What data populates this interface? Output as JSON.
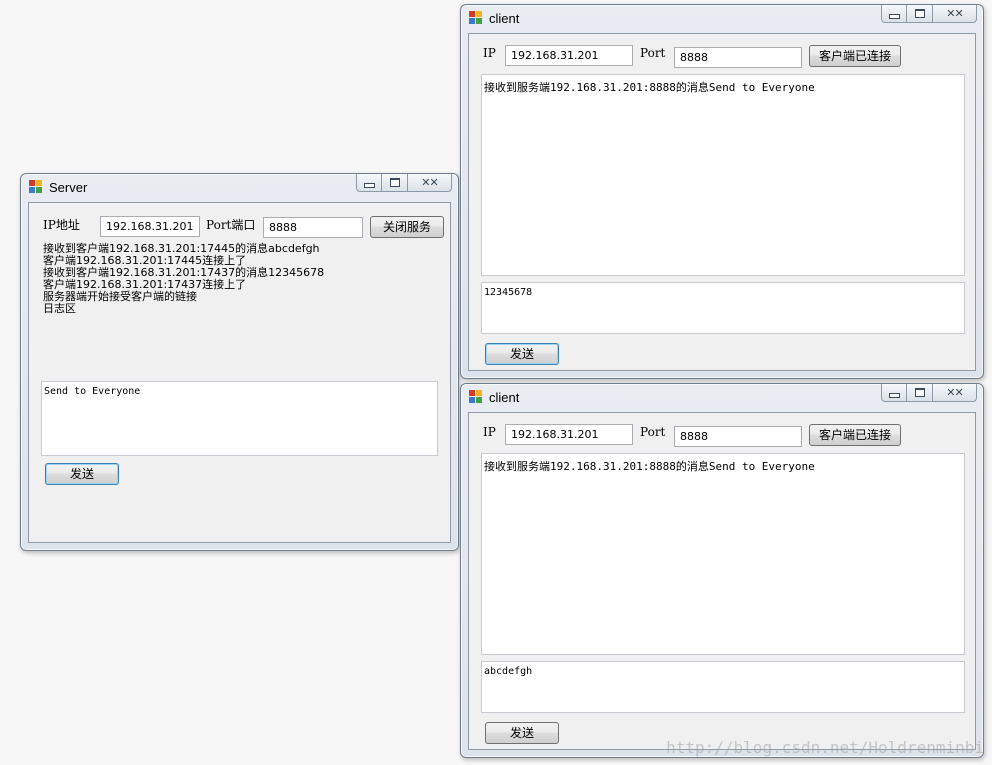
{
  "server": {
    "title": "Server",
    "ip_label": "IP地址",
    "ip_value": "192.168.31.201",
    "port_label": "Port端口",
    "port_value": "8888",
    "toggle_button": "关闭服务",
    "log_lines": [
      "接收到客户端192.168.31.201:17445的消息abcdefgh",
      "客户端192.168.31.201:17445连接上了",
      "接收到客户端192.168.31.201:17437的消息12345678",
      "客户端192.168.31.201:17437连接上了",
      "服务器端开始接受客户端的链接",
      "日志区"
    ],
    "message_value": "Send to Everyone",
    "send_button": "发送"
  },
  "clients": [
    {
      "title": "client",
      "ip_label": "IP",
      "ip_value": "192.168.31.201",
      "port_label": "Port",
      "port_value": "8888",
      "connect_button": "客户端已连接",
      "received_text": "接收到服务端192.168.31.201:8888的消息Send to Everyone",
      "message_value": "12345678",
      "send_button": "发送"
    },
    {
      "title": "client",
      "ip_label": "IP",
      "ip_value": "192.168.31.201",
      "port_label": "Port",
      "port_value": "8888",
      "connect_button": "客户端已连接",
      "received_text": "接收到服务端192.168.31.201:8888的消息Send to Everyone",
      "message_value": "abcdefgh",
      "send_button": "发送"
    }
  ],
  "watermark": "http://blog.csdn.net/Holdrenminbi",
  "icons": {
    "app": "winforms-app-icon",
    "minimize": "minimize-icon",
    "maximize": "maximize-icon",
    "close": "close-icon"
  }
}
